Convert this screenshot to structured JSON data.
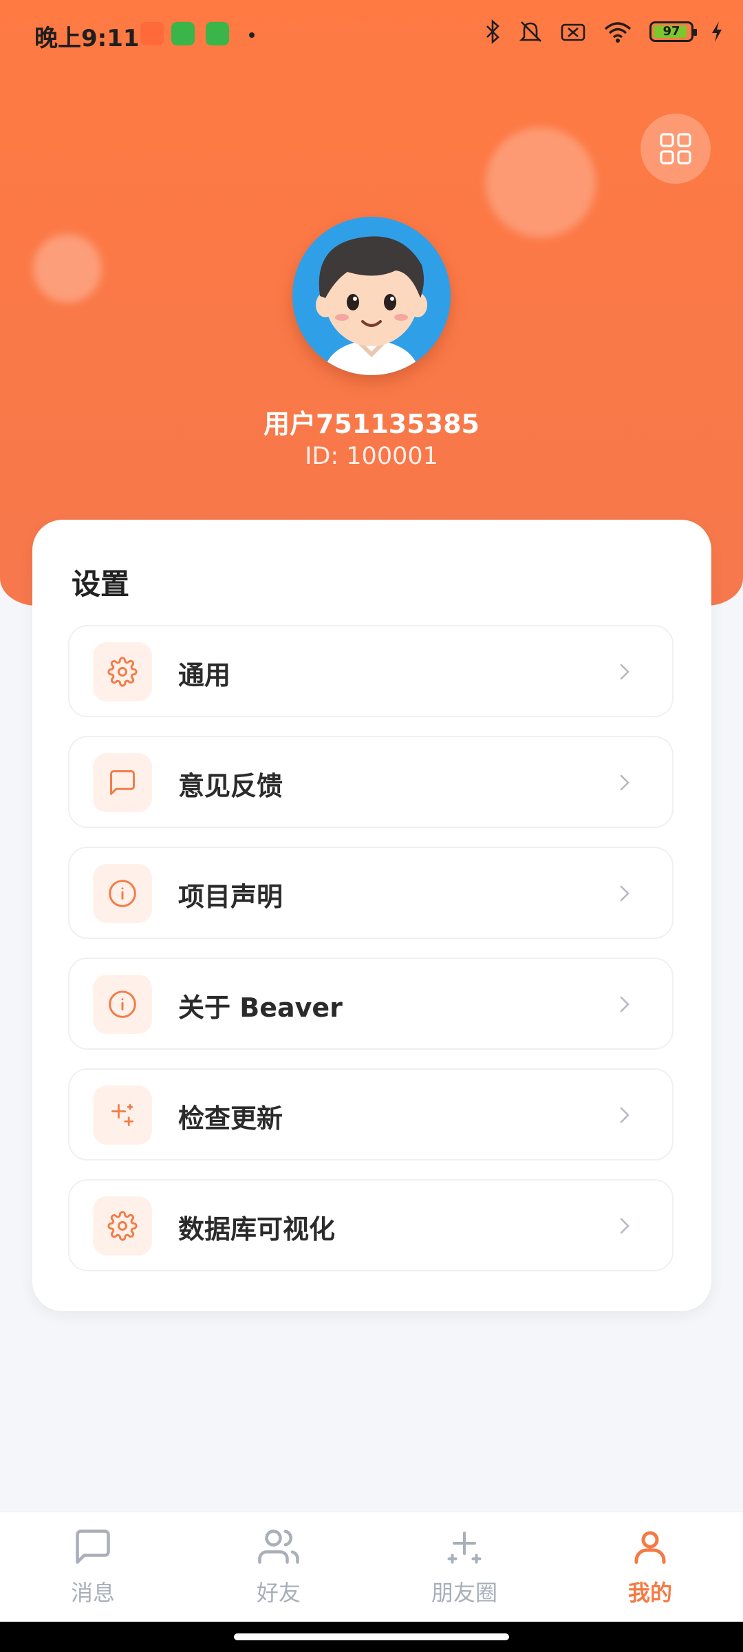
{
  "status_bar": {
    "time": "晚上9:11",
    "battery": "97",
    "icons": [
      "bluetooth-icon",
      "mute-icon",
      "sim-off-icon",
      "wifi-icon",
      "battery-icon",
      "charging-icon"
    ]
  },
  "profile": {
    "username": "用户751135385",
    "id_text": "ID: 100001"
  },
  "settings": {
    "title": "设置",
    "items": [
      {
        "label": "通用",
        "icon": "gear-icon"
      },
      {
        "label": "意见反馈",
        "icon": "chat-icon"
      },
      {
        "label": "项目声明",
        "icon": "info-icon"
      },
      {
        "label": "关于 Beaver",
        "icon": "info-icon"
      },
      {
        "label": "检查更新",
        "icon": "sparkle-icon"
      },
      {
        "label": "数据库可视化",
        "icon": "gear-icon"
      }
    ]
  },
  "tabbar": {
    "tabs": [
      {
        "label": "消息",
        "icon": "message-icon",
        "active": false
      },
      {
        "label": "好友",
        "icon": "friends-icon",
        "active": false
      },
      {
        "label": "朋友圈",
        "icon": "sparkle-icon",
        "active": false
      },
      {
        "label": "我的",
        "icon": "user-icon",
        "active": true
      }
    ]
  },
  "colors": {
    "accent": "#F47A45",
    "header_bg": "#FF7A43",
    "icon_bg": "#FFF1EA",
    "inactive": "#A8AFB9"
  }
}
